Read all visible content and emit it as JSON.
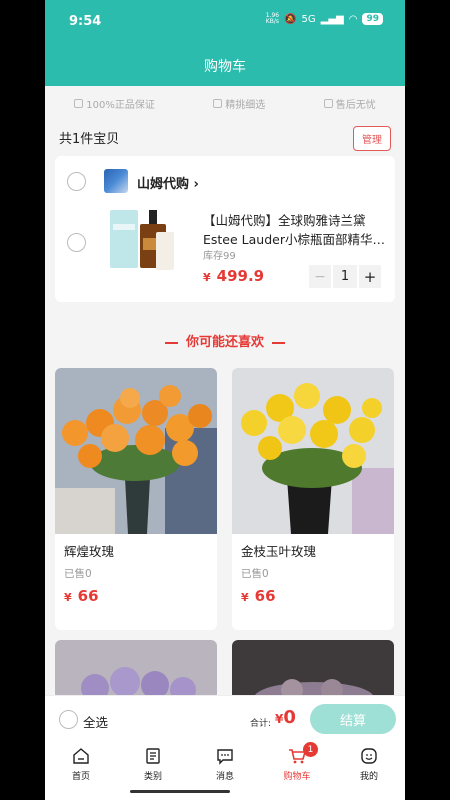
{
  "status_bar": {
    "time": "9:54",
    "network_speed": "1.96\nKB/s",
    "signal": "5G",
    "battery": "99"
  },
  "header": {
    "title": "购物车"
  },
  "guarantees": [
    "100%正品保证",
    "精挑细选",
    "售后无忧"
  ],
  "cart": {
    "count_label": "共1件宝贝",
    "manage_label": "管理",
    "shop": {
      "name": "山姆代购"
    },
    "item": {
      "title": "【山姆代购】全球购雅诗兰黛Estee Lauder小棕瓶面部精华…",
      "stock": "库存99",
      "currency": "¥",
      "price": "499.9",
      "quantity": "1",
      "minus": "−",
      "plus": "+"
    }
  },
  "recommend": {
    "heading": "你可能还喜欢",
    "items": [
      {
        "name": "辉煌玫瑰",
        "sold": "已售0",
        "currency": "¥",
        "price": "66"
      },
      {
        "name": "金枝玉叶玫瑰",
        "sold": "已售0",
        "currency": "¥",
        "price": "66"
      }
    ]
  },
  "checkout": {
    "select_all": "全选",
    "total_label": "合计:",
    "currency": "¥",
    "total": "0",
    "pay_label": "结算"
  },
  "tabbar": {
    "items": [
      {
        "label": "首页",
        "icon": "home-icon"
      },
      {
        "label": "类别",
        "icon": "category-icon"
      },
      {
        "label": "消息",
        "icon": "message-icon"
      },
      {
        "label": "购物车",
        "icon": "cart-icon",
        "badge": "1",
        "active": true
      },
      {
        "label": "我的",
        "icon": "profile-icon"
      }
    ]
  },
  "colors": {
    "brand": "#2bbcae",
    "price": "#e53935",
    "pay_button": "#9ee0d6"
  }
}
